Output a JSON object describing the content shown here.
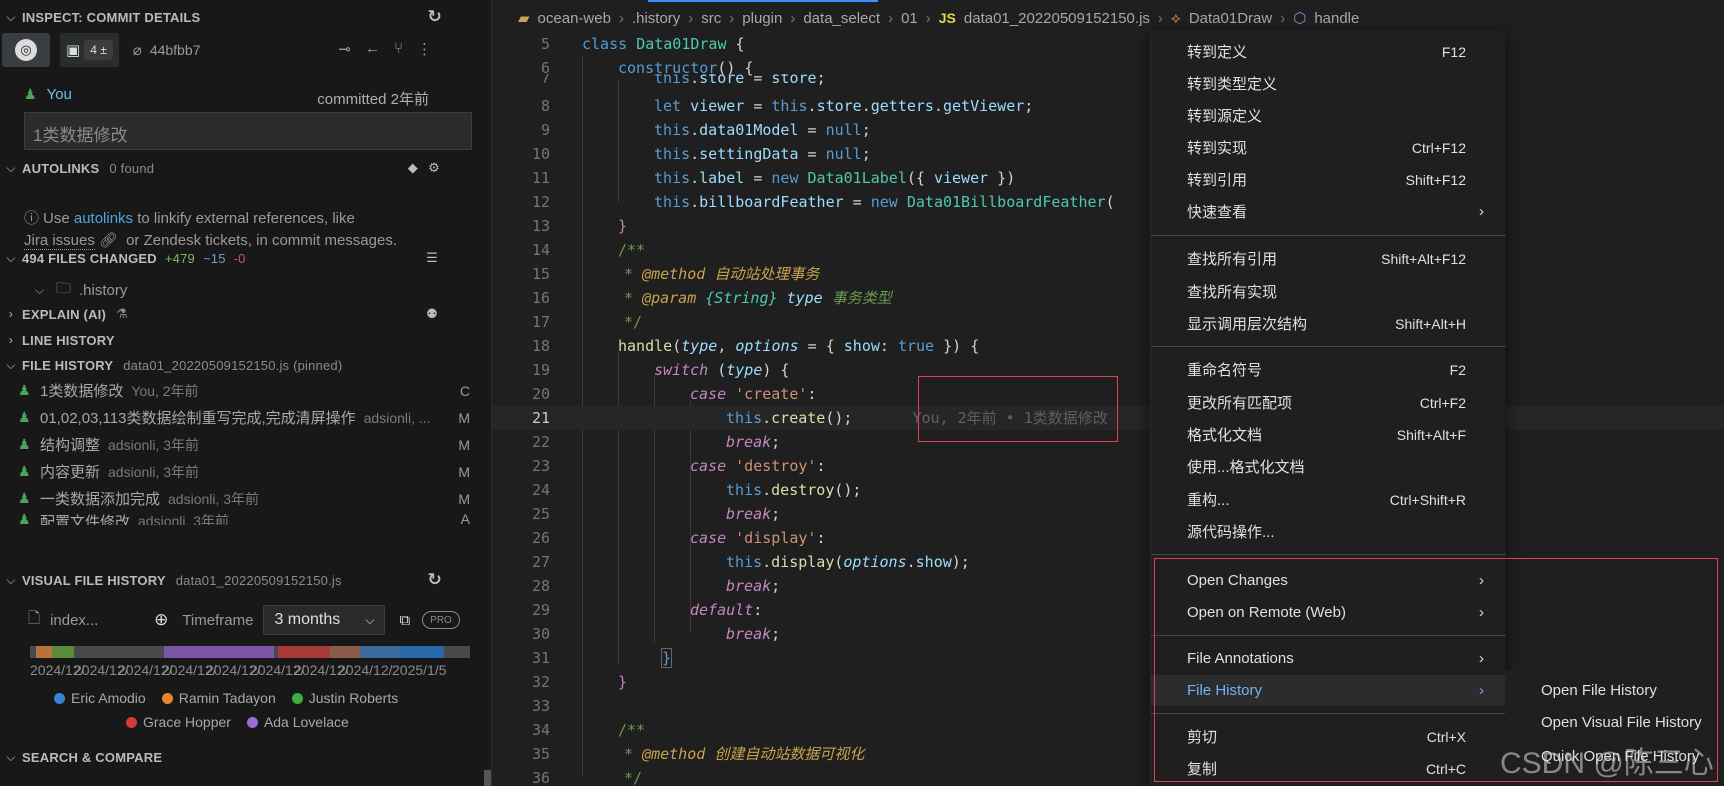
{
  "sidebar": {
    "inspect_title": "INSPECT: COMMIT DETAILS",
    "toolbar": {
      "changes_pill": "4 ±",
      "sha": "44bfbb7"
    },
    "commit": {
      "author": "You",
      "time": "committed 2年前",
      "message": "1类数据修改"
    },
    "autolinks": {
      "title": "AUTOLINKS",
      "count": "0 found",
      "text_pre": "Use ",
      "link": "autolinks",
      "text_mid": " to linkify external references, like",
      "jira": "Jira issues",
      "text_post": " or Zendesk tickets, in commit messages."
    },
    "files_changed": {
      "title": "494 FILES CHANGED",
      "added": "+479",
      "changed": "~15",
      "removed": "-0",
      "folder": ".history"
    },
    "explain": "EXPLAIN (AI)",
    "line_history": "LINE HISTORY",
    "file_history": {
      "title": "FILE HISTORY",
      "file": "data01_20220509152150.js (pinned)",
      "rows": [
        {
          "title": "1类数据修改",
          "meta": "You, 2年前",
          "status": "C"
        },
        {
          "title": "01,02,03,113类数据绘制重写完成,完成清屏操作",
          "meta": "adsionli, ...",
          "status": "M"
        },
        {
          "title": "结构调整",
          "meta": "adsionli, 3年前",
          "status": "M"
        },
        {
          "title": "内容更新",
          "meta": "adsionli, 3年前",
          "status": "M"
        },
        {
          "title": "一类数据添加完成",
          "meta": "adsionli, 3年前",
          "status": "M"
        },
        {
          "title": "配置文件修改",
          "meta": "adsionli, 3年前",
          "status": "A"
        }
      ]
    },
    "visual_file_history": {
      "title": "VISUAL FILE HISTORY",
      "file": "data01_20220509152150.js",
      "index_label": "index...",
      "timeframe_label": "Timeframe",
      "timeframe_value": "3 months",
      "pro": "PRO",
      "dates": [
        "2024/12/",
        "2024/12/",
        "2024/12/",
        "2024/12/",
        "2024/12/",
        "2024/12/",
        "2024/12/",
        "2024/12/",
        "2025/1/5"
      ],
      "legend": [
        {
          "name": "Eric Amodio",
          "color": "#3b82d6"
        },
        {
          "name": "Ramin Tadayon",
          "color": "#e8842c"
        },
        {
          "name": "Justin Roberts",
          "color": "#3fae3f"
        },
        {
          "name": "Grace Hopper",
          "color": "#d63b3b"
        },
        {
          "name": "Ada Lovelace",
          "color": "#9c6bd1"
        }
      ]
    },
    "search_compare": "SEARCH & COMPARE"
  },
  "editor": {
    "breadcrumb": [
      "ocean-web",
      ".history",
      "src",
      "plugin",
      "data_select",
      "01",
      "data01_20220509152150.js",
      "Data01Draw",
      "handle"
    ],
    "js_badge": "JS",
    "blame": "You, 2年前 • 1类数据修改",
    "line_numbers": [
      "5",
      "6",
      "7",
      "8",
      "9",
      "10",
      "11",
      "12",
      "13",
      "14",
      "15",
      "16",
      "17",
      "18",
      "19",
      "20",
      "21",
      "22",
      "23",
      "24",
      "25",
      "26",
      "27",
      "28",
      "29",
      "30",
      "31",
      "32",
      "33",
      "34",
      "35",
      "36"
    ]
  },
  "context_menu": {
    "items": [
      {
        "label": "转到定义",
        "key": "F12"
      },
      {
        "label": "转到类型定义",
        "key": ""
      },
      {
        "label": "转到源定义",
        "key": ""
      },
      {
        "label": "转到实现",
        "key": "Ctrl+F12"
      },
      {
        "label": "转到引用",
        "key": "Shift+F12"
      },
      {
        "label": "快速查看",
        "key": ""
      },
      {
        "label": "查找所有引用",
        "key": "Shift+Alt+F12"
      },
      {
        "label": "查找所有实现",
        "key": ""
      },
      {
        "label": "显示调用层次结构",
        "key": "Shift+Alt+H"
      },
      {
        "label": "重命名符号",
        "key": "F2"
      },
      {
        "label": "更改所有匹配项",
        "key": "Ctrl+F2"
      },
      {
        "label": "格式化文档",
        "key": "Shift+Alt+F"
      },
      {
        "label": "使用...格式化文档",
        "key": ""
      },
      {
        "label": "重构...",
        "key": "Ctrl+Shift+R"
      },
      {
        "label": "源代码操作...",
        "key": ""
      },
      {
        "label": "Open Changes",
        "key": ""
      },
      {
        "label": "Open on Remote (Web)",
        "key": ""
      },
      {
        "label": "File Annotations",
        "key": ""
      },
      {
        "label": "File History",
        "key": ""
      },
      {
        "label": "剪切",
        "key": "Ctrl+X"
      },
      {
        "label": "复制",
        "key": "Ctrl+C"
      }
    ]
  },
  "submenu": {
    "items": [
      "Open File History",
      "Open Visual File History",
      "Quick Open File History"
    ]
  },
  "watermark": "CSDN @陈三心"
}
